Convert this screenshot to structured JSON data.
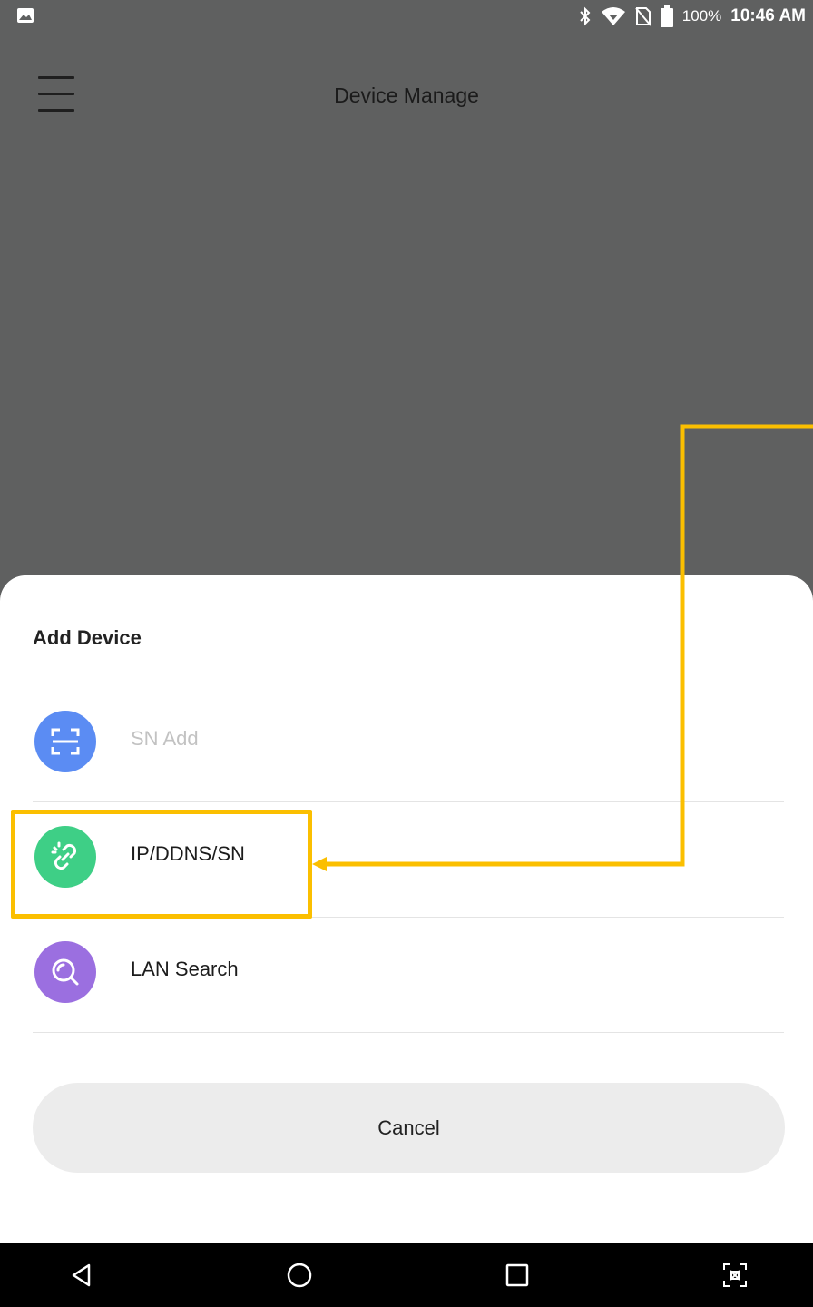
{
  "status_bar": {
    "battery_percent": "100%",
    "time": "10:46 AM",
    "icons": [
      "gallery-icon",
      "bluetooth-icon",
      "wifi-icon",
      "no-sim-icon",
      "battery-icon"
    ]
  },
  "app_bar": {
    "title": "Device Manage",
    "menu_icon": "hamburger-menu-icon"
  },
  "sheet": {
    "title": "Add Device",
    "options": [
      {
        "label": "SN Add",
        "icon": "scan-icon",
        "color": "#5b8cf3",
        "enabled": false
      },
      {
        "label": "IP/DDNS/SN",
        "icon": "link-icon",
        "color": "#3ecf86",
        "enabled": true,
        "highlighted": true
      },
      {
        "label": "LAN Search",
        "icon": "search-icon",
        "color": "#9b6fe0",
        "enabled": true
      }
    ],
    "cancel_label": "Cancel"
  },
  "annotation": {
    "color": "#fbbf00"
  },
  "nav_bar": {
    "icons": [
      "back-icon",
      "home-icon",
      "recents-icon",
      "screenshot-icon"
    ]
  }
}
